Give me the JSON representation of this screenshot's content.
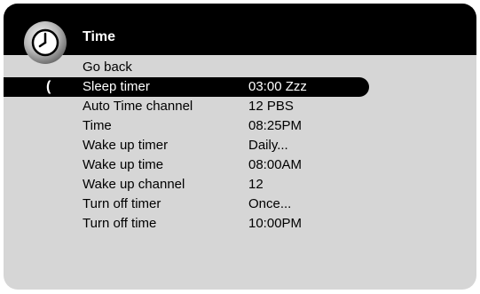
{
  "menu": {
    "title": "Time",
    "icon": "clock-icon",
    "cursor_glyph": "(",
    "items": [
      {
        "label": "Go back",
        "value": ""
      },
      {
        "label": "Sleep timer",
        "value": "03:00 Zzz",
        "selected": true
      },
      {
        "label": "Auto Time channel",
        "value": "12 PBS"
      },
      {
        "label": "Time",
        "value": "08:25PM"
      },
      {
        "label": "Wake up timer",
        "value": "Daily..."
      },
      {
        "label": "Wake up time",
        "value": "08:00AM"
      },
      {
        "label": "Wake up channel",
        "value": "12"
      },
      {
        "label": "Turn off timer",
        "value": "Once..."
      },
      {
        "label": "Turn off time",
        "value": "10:00PM"
      }
    ]
  },
  "colors": {
    "panel": "#d6d6d6",
    "header": "#000000",
    "selection": "#000000",
    "text": "#000000",
    "selected_text": "#ffffff"
  }
}
